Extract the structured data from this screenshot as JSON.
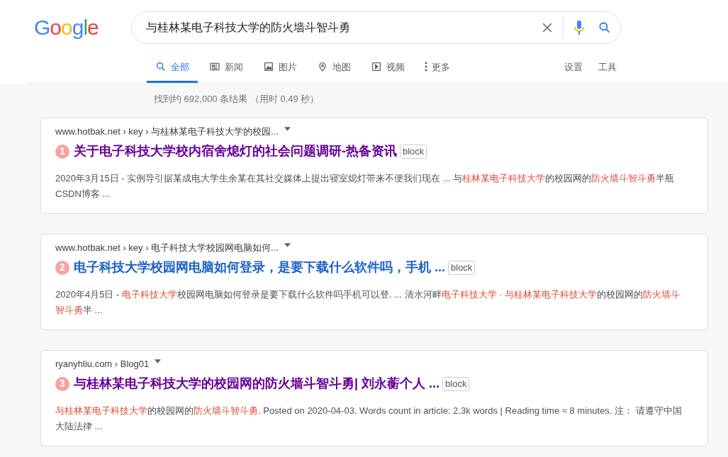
{
  "logo": "Google",
  "search": {
    "value": "与桂林某电子科技大学的防火墙斗智斗勇"
  },
  "tabs": [
    {
      "label": "全部",
      "kind": "search",
      "selected": true
    },
    {
      "label": "新闻",
      "kind": "news",
      "selected": false
    },
    {
      "label": "图片",
      "kind": "image",
      "selected": false
    },
    {
      "label": "地图",
      "kind": "pin",
      "selected": false
    },
    {
      "label": "视频",
      "kind": "play",
      "selected": false
    },
    {
      "label": "更多",
      "kind": "dots",
      "selected": false
    }
  ],
  "tools": [
    "设置",
    "工具"
  ],
  "result_stats": "找到约 692,000 条结果 （用时 0.49 秒）",
  "results": [
    {
      "breadcrumb": "www.hotbak.net › key › 与桂林某电子科技大学的校园...",
      "number": "1",
      "title": "关于电子科技大学校内宿舍熄灯的社会问题调研-热备资讯",
      "visited": true,
      "block": "block",
      "snippet": [
        {
          "text": "2020年3月15日 - 实例导引据某成电大学生余某在其社交媒体上提出寝室熄灯带来不便我们现在 ... 与",
          "highlight": false
        },
        {
          "text": "桂林某电子科技大学",
          "highlight": true
        },
        {
          "text": "的校园网的",
          "highlight": false
        },
        {
          "text": "防火墙斗智斗勇",
          "highlight": true
        },
        {
          "text": "半瓶CSDN博客 ...",
          "highlight": false
        }
      ]
    },
    {
      "breadcrumb": "www.hotbak.net › key › 电子科技大学校园网电脑如何...",
      "number": "2",
      "title": "电子科技大学校园网电脑如何登录，是要下载什么软件吗，手机 ...",
      "visited": false,
      "block": "block",
      "snippet": [
        {
          "text": "2020年4月5日 - ",
          "highlight": false
        },
        {
          "text": "电子科技大学",
          "highlight": true
        },
        {
          "text": "校园网电脑如何登录是要下载什么软件吗手机可以登. ... 清水河畔",
          "highlight": false
        },
        {
          "text": "电子科技大学 · 与桂林某电子科技大学",
          "highlight": true
        },
        {
          "text": "的校园网的",
          "highlight": false
        },
        {
          "text": "防火墙斗智斗勇",
          "highlight": true
        },
        {
          "text": "半 ...",
          "highlight": false
        }
      ]
    },
    {
      "breadcrumb": "ryanyhliu.com › Blog01",
      "number": "3",
      "title": "与桂林某电子科技大学的校园网的防火墙斗智斗勇| 刘永蘅个人 ...",
      "visited": true,
      "block": "block",
      "snippet": [
        {
          "text": "与桂林某电子科技大学",
          "highlight": true
        },
        {
          "text": "的校园网的",
          "highlight": false
        },
        {
          "text": "防火墙斗智斗勇",
          "highlight": true
        },
        {
          "text": ". Posted on 2020-04-03. Words count in article: 2.3k words | Reading time ≈ 8 minutes. 注： 请遵守中国大陆法律 ...",
          "highlight": false
        }
      ]
    }
  ]
}
